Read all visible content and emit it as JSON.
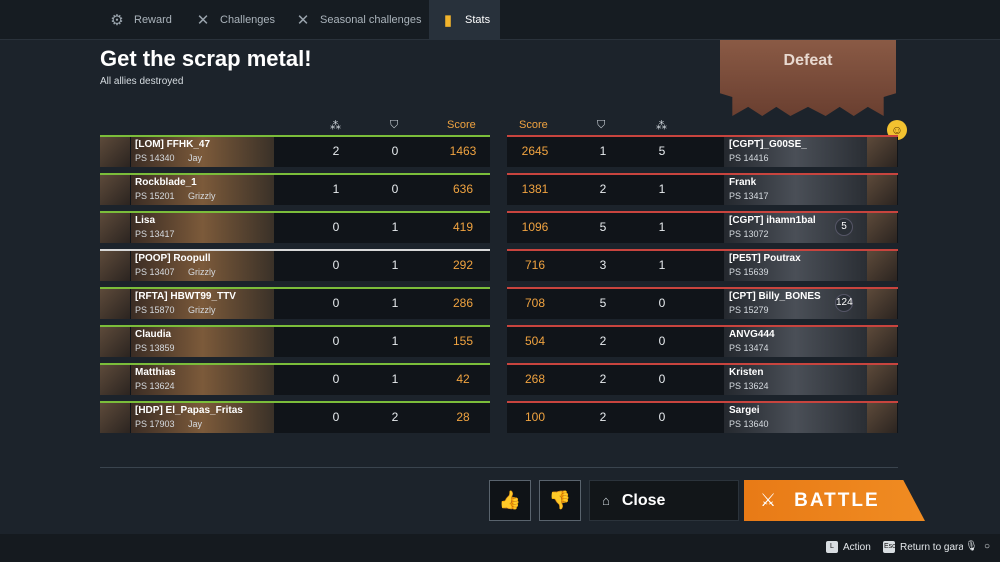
{
  "tabs": [
    {
      "label": "Reward",
      "icon": "gear-icon",
      "active": false
    },
    {
      "label": "Challenges",
      "icon": "crossed-swords-icon",
      "active": false
    },
    {
      "label": "Seasonal challenges",
      "icon": "crossed-swords-icon",
      "active": false
    },
    {
      "label": "Stats",
      "icon": "stats-book-icon",
      "active": true
    }
  ],
  "title": "Get the scrap metal!",
  "subtitle": "All allies destroyed",
  "result": "Defeat",
  "headers": {
    "score": "Score"
  },
  "allies": [
    {
      "name": "[LOM] FFHK_47",
      "ps": "PS 14340",
      "clan": "Jay",
      "kills": "2",
      "assists": "0",
      "score": "1463",
      "border": "green"
    },
    {
      "name": "Rockblade_1",
      "ps": "PS 15201",
      "clan": "Grizzly",
      "kills": "1",
      "assists": "0",
      "score": "636",
      "border": "green"
    },
    {
      "name": "Lisa",
      "ps": "PS 13417",
      "clan": "",
      "kills": "0",
      "assists": "1",
      "score": "419",
      "border": "green"
    },
    {
      "name": "[POOP] Roopull",
      "ps": "PS 13407",
      "clan": "Grizzly",
      "kills": "0",
      "assists": "1",
      "score": "292",
      "border": "white"
    },
    {
      "name": "[RFTA] HBWT99_TTV",
      "ps": "PS 15870",
      "clan": "Grizzly",
      "kills": "0",
      "assists": "1",
      "score": "286",
      "border": "green"
    },
    {
      "name": "Claudia",
      "ps": "PS 13859",
      "clan": "",
      "kills": "0",
      "assists": "1",
      "score": "155",
      "border": "green"
    },
    {
      "name": "Matthias",
      "ps": "PS 13624",
      "clan": "",
      "kills": "0",
      "assists": "1",
      "score": "42",
      "border": "green"
    },
    {
      "name": "[HDP] El_Papas_Fritas",
      "ps": "PS 17903",
      "clan": "Jay",
      "kills": "0",
      "assists": "2",
      "score": "28",
      "border": "green"
    }
  ],
  "enemies": [
    {
      "name": "[CGPT]_G00SE_",
      "ps": "PS 14416",
      "score": "2645",
      "assists": "1",
      "kills": "5",
      "badge": "",
      "border": "red"
    },
    {
      "name": "Frank",
      "ps": "PS 13417",
      "score": "1381",
      "assists": "2",
      "kills": "1",
      "badge": "",
      "border": "red"
    },
    {
      "name": "[CGPT] ihamn1bal",
      "ps": "PS 13072",
      "score": "1096",
      "assists": "5",
      "kills": "1",
      "badge": "5",
      "border": "red"
    },
    {
      "name": "[PE5T] Poutrax",
      "ps": "PS 15639",
      "score": "716",
      "assists": "3",
      "kills": "1",
      "badge": "",
      "border": "red"
    },
    {
      "name": "[CPT] Billy_BONES",
      "ps": "PS 15279",
      "score": "708",
      "assists": "5",
      "kills": "0",
      "badge": "124",
      "border": "red"
    },
    {
      "name": "ANVG444",
      "ps": "PS 13474",
      "score": "504",
      "assists": "2",
      "kills": "0",
      "badge": "",
      "border": "red"
    },
    {
      "name": "Kristen",
      "ps": "PS 13624",
      "score": "268",
      "assists": "2",
      "kills": "0",
      "badge": "",
      "border": "red"
    },
    {
      "name": "Sargei",
      "ps": "PS 13640",
      "score": "100",
      "assists": "2",
      "kills": "0",
      "badge": "",
      "border": "red"
    }
  ],
  "buttons": {
    "like": "thumbs-up-icon",
    "dislike": "thumbs-down-icon",
    "close": "Close",
    "battle": "BATTLE"
  },
  "footer": {
    "action": "Action",
    "return": "Return to garage",
    "mouse_key": "L",
    "esc_key": "Esc"
  },
  "colors": {
    "accent": "#f08c22",
    "ally": "#7bbd3a",
    "enemy": "#c8443e",
    "score": "#f0a340"
  }
}
